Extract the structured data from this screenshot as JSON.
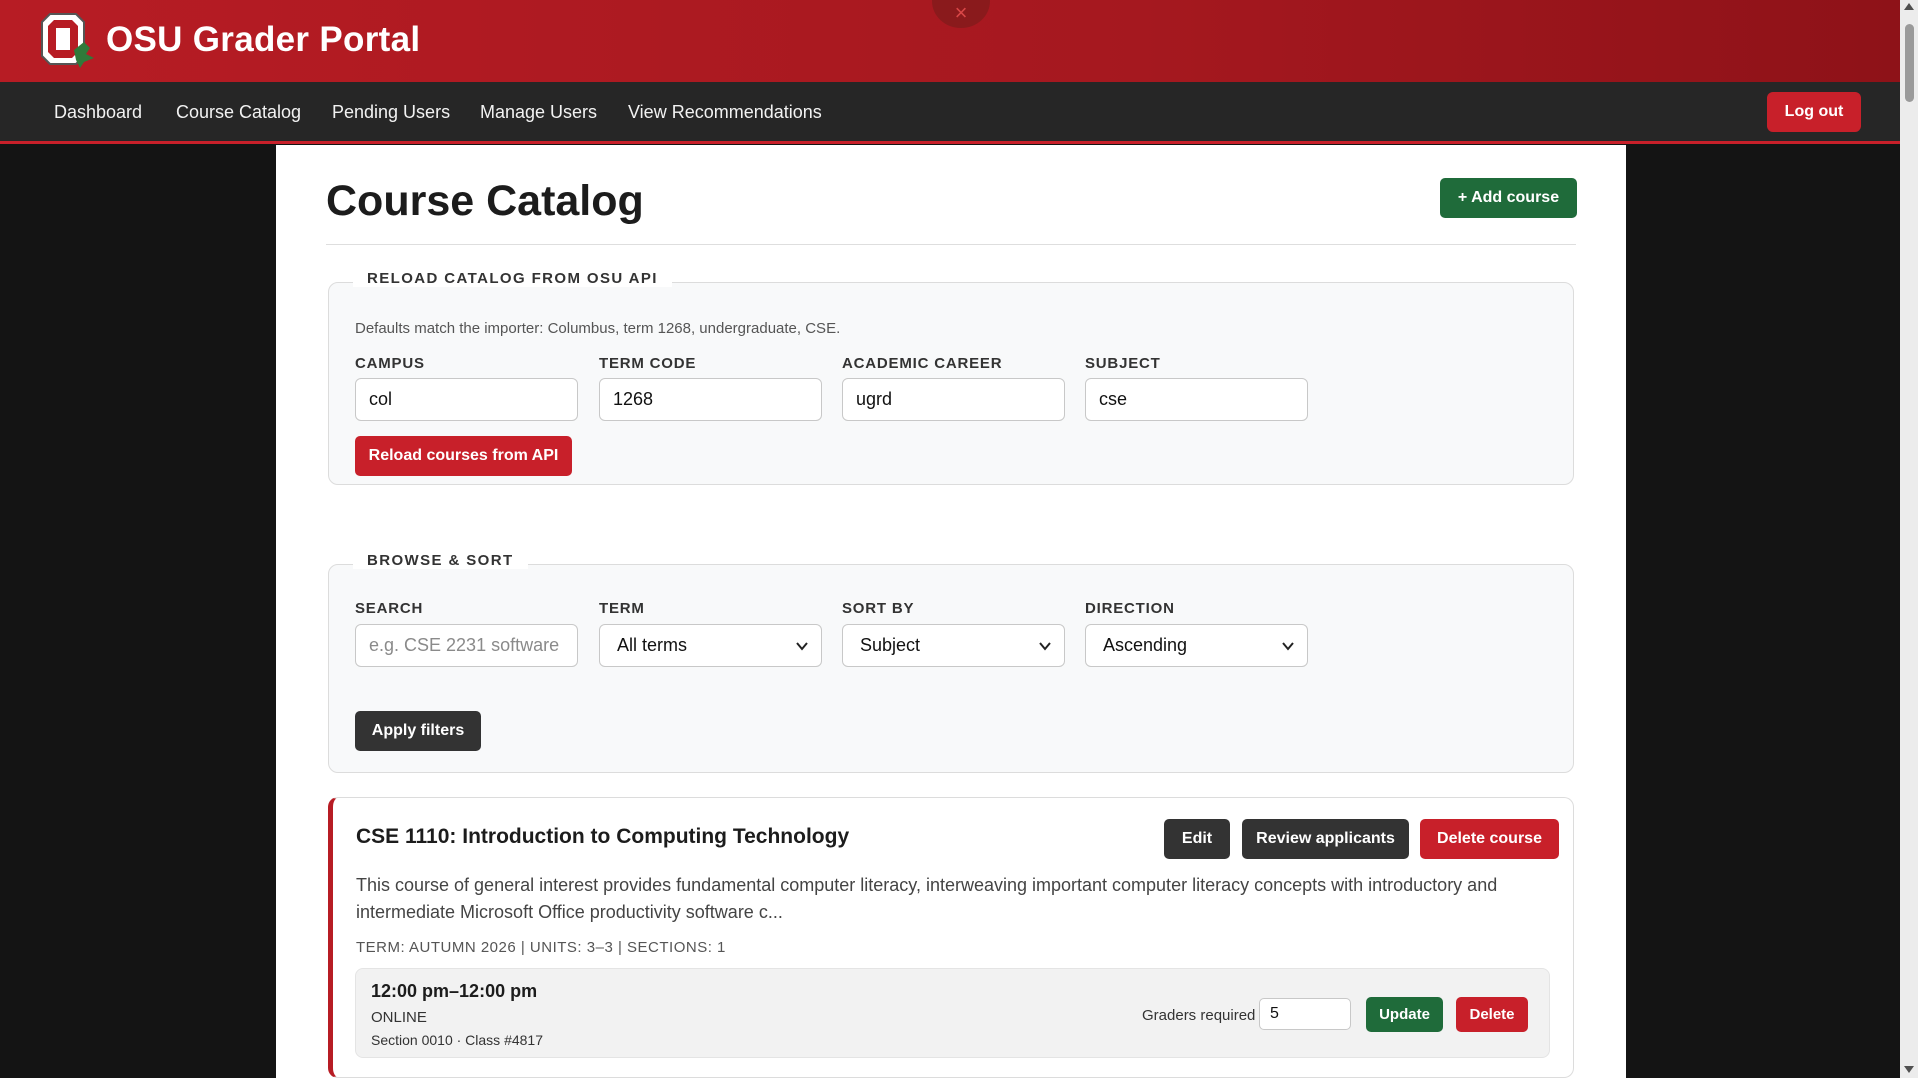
{
  "app": {
    "title": "OSU Grader Portal",
    "close_glyph": "×"
  },
  "nav": {
    "links": [
      "Dashboard",
      "Course Catalog",
      "Pending Users",
      "Manage Users",
      "View Recommendations"
    ],
    "logout": "Log out"
  },
  "page": {
    "title": "Course Catalog",
    "add_button": "+ Add course"
  },
  "reload": {
    "legend": "RELOAD CATALOG FROM OSU API",
    "hint": "Defaults match the importer: Columbus, term 1268, undergraduate, CSE.",
    "fields": [
      {
        "label": "CAMPUS",
        "value": "col"
      },
      {
        "label": "TERM CODE",
        "value": "1268"
      },
      {
        "label": "ACADEMIC CAREER",
        "value": "ugrd"
      },
      {
        "label": "SUBJECT",
        "value": "cse"
      }
    ],
    "button": "Reload courses from API"
  },
  "browse": {
    "legend": "BROWSE & SORT",
    "search": {
      "label": "SEARCH",
      "placeholder": "e.g. CSE 2231 software"
    },
    "term": {
      "label": "TERM",
      "value": "All terms"
    },
    "sort_by": {
      "label": "SORT BY",
      "value": "Subject"
    },
    "direction": {
      "label": "DIRECTION",
      "value": "Ascending"
    },
    "button": "Apply filters"
  },
  "courses": [
    {
      "title": "CSE 1110: Introduction to Computing Technology",
      "description": "This course of general interest provides fundamental computer literacy, interweaving important computer literacy concepts with introductory and intermediate Microsoft Office productivity software c...",
      "meta": "TERM: AUTUMN 2026 | UNITS: 3–3 | SECTIONS: 1",
      "actions": {
        "edit": "Edit",
        "review": "Review applicants",
        "delete": "Delete course"
      },
      "sections": [
        {
          "time": "12:00 pm–12:00 pm",
          "mode": "ONLINE",
          "id": "Section 0010 · Class #4817",
          "graders_label": "Graders required",
          "graders_value": "5",
          "update": "Update",
          "delete": "Delete"
        }
      ]
    }
  ],
  "colors": {
    "brand_red": "#b71c24",
    "nav_bg": "#262626",
    "green": "#1f6b3a",
    "dark_button": "#333333"
  },
  "icons": {
    "logo": "block-o-logo-icon",
    "chevron": "chevron-down-icon"
  }
}
